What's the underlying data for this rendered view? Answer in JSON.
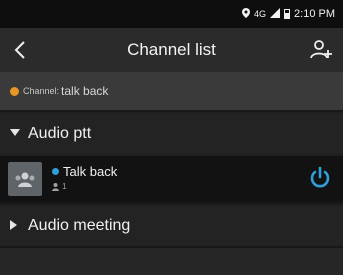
{
  "status_bar": {
    "network": "4G",
    "time": "2:10 PM"
  },
  "app_bar": {
    "title": "Channel list",
    "back_icon": "chevron-left-icon",
    "action_icon": "user-add-icon"
  },
  "current_channel": {
    "prefix": "Channel:",
    "name": "talk back",
    "indicator_color": "#e59625"
  },
  "groups": [
    {
      "label": "Audio ptt",
      "expanded": true,
      "channels": [
        {
          "name": "Talk back",
          "member_count": "1",
          "online_color": "#2e9fd8",
          "power_icon": "power-icon",
          "power_color": "#2e9fd8"
        }
      ]
    },
    {
      "label": "Audio meeting",
      "expanded": false,
      "channels": []
    }
  ],
  "colors": {
    "accent": "#2e9fd8",
    "warning": "#e59625",
    "background": "#1f1f1f"
  }
}
